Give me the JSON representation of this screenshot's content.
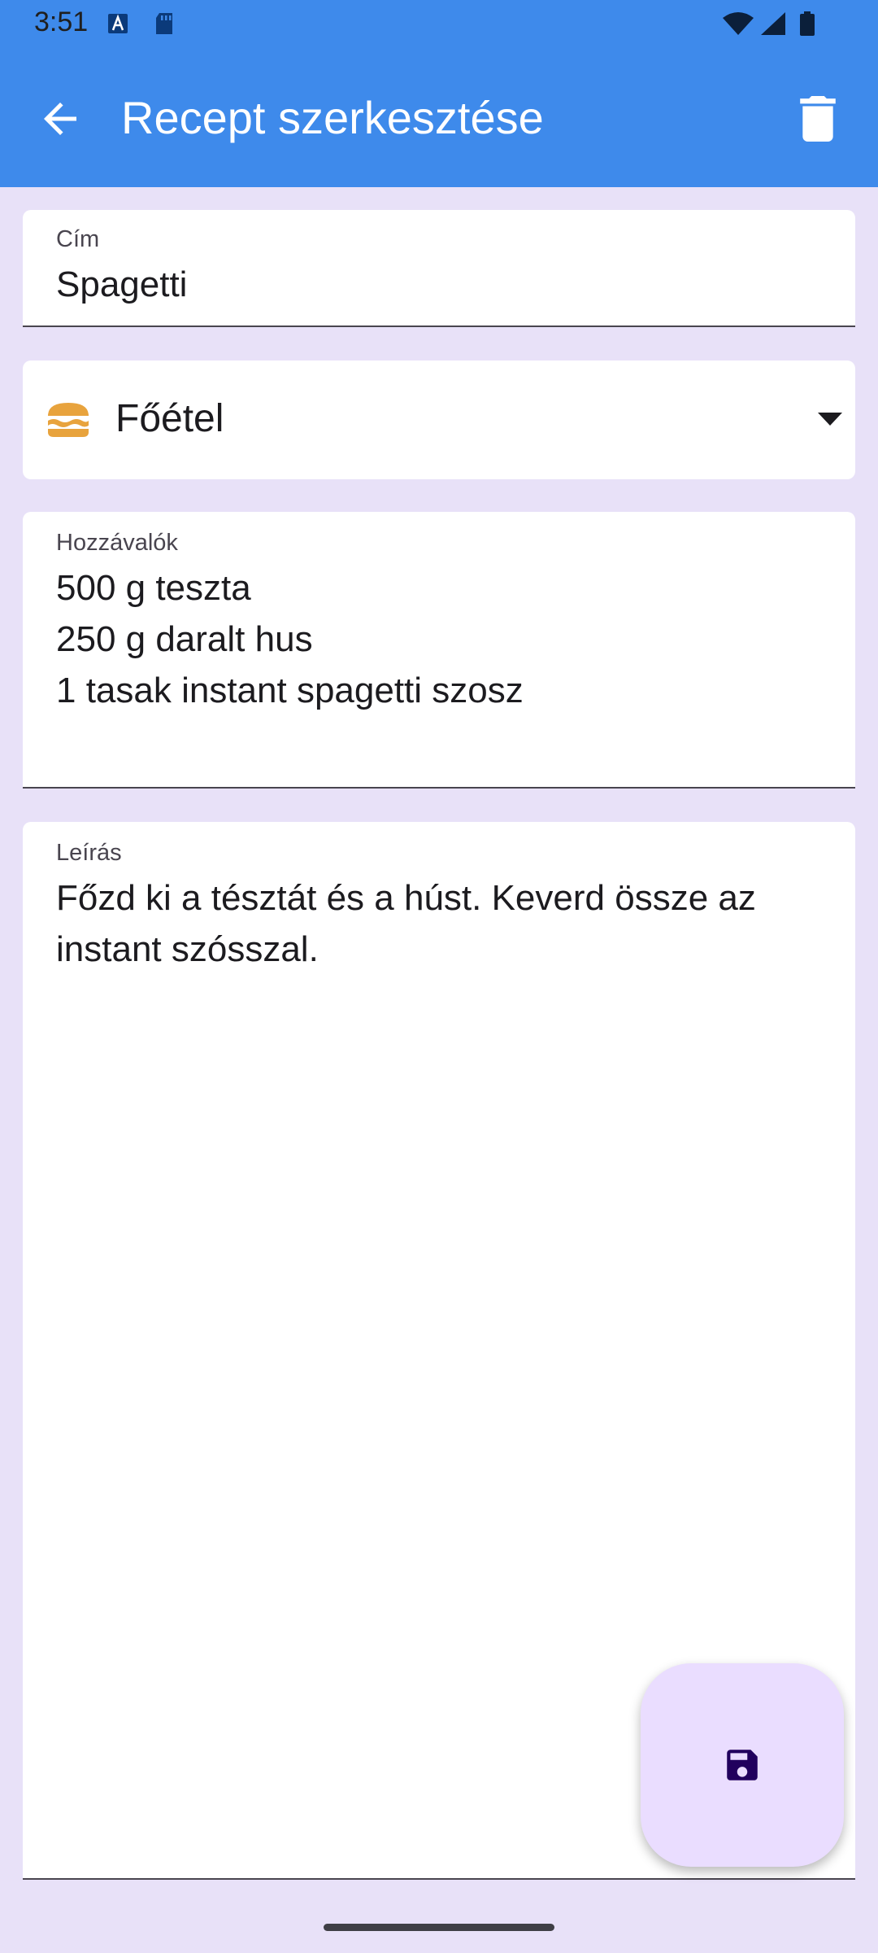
{
  "status_bar": {
    "time": "3:51",
    "icons": [
      "notification-a-icon",
      "sd-card-icon",
      "wifi-icon",
      "cellular-signal-icon",
      "battery-icon"
    ]
  },
  "app_bar": {
    "title": "Recept szerkesztése",
    "back_icon": "arrow-back-icon",
    "delete_icon": "trash-icon",
    "background_color": "#3E8AEB"
  },
  "form": {
    "title_field": {
      "label": "Cím",
      "value": "Spagetti"
    },
    "category": {
      "selected": "Főétel",
      "icon": "burger-icon",
      "dropdown_icon": "arrow-drop-down-icon"
    },
    "ingredients_field": {
      "label": "Hozzávalók",
      "value": "500 g teszta\n250 g daralt hus\n1 tasak instant spagetti szosz"
    },
    "description_field": {
      "label": "Leírás",
      "value": "Főzd ki a tésztát és a húst. Keverd össze az instant szósszal."
    }
  },
  "fab": {
    "icon": "save-icon",
    "color": "#EADDFF"
  },
  "colors": {
    "page_background": "#E8E1F8",
    "accent": "#3E8AEB",
    "burger": "#E8A33D"
  }
}
